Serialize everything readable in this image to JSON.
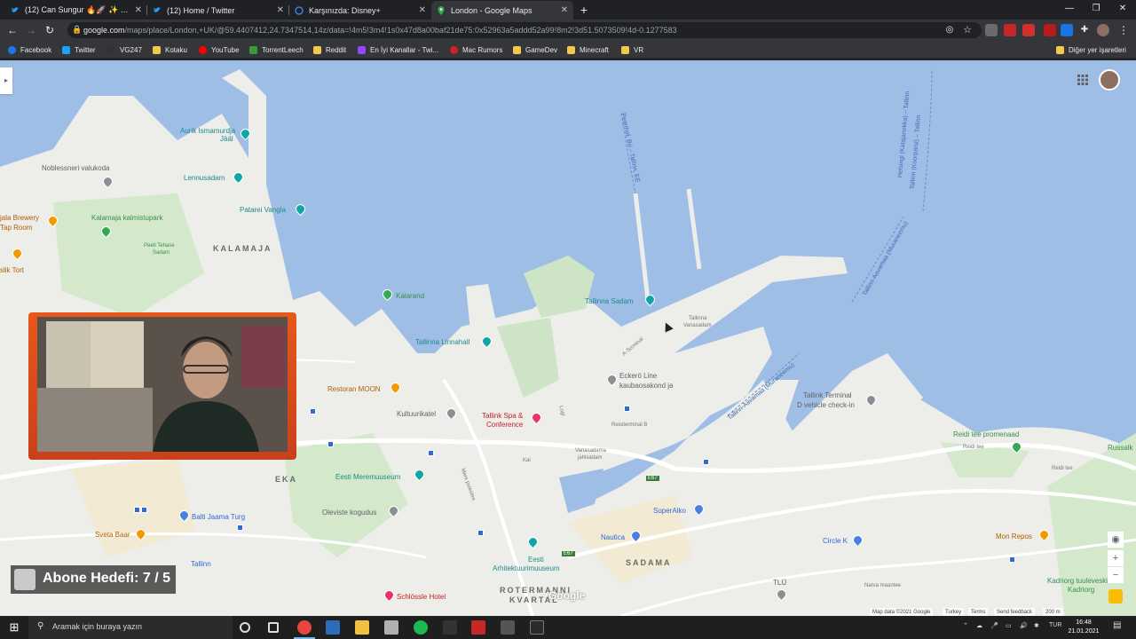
{
  "browser": {
    "tabs": [
      {
        "title": "(12) Can Sungur 🔥🚀 ✨ #KalkC",
        "icon": "twitter-icon",
        "active": false
      },
      {
        "title": "(12) Home / Twitter",
        "icon": "twitter-icon",
        "active": false
      },
      {
        "title": "Karşınızda: Disney+",
        "icon": "disney-icon",
        "active": false
      },
      {
        "title": "London - Google Maps",
        "icon": "maps-pin-icon",
        "active": true
      }
    ],
    "url_main": "google.com",
    "url_rest": "/maps/place/London,+UK/@59.4407412,24.7347514,14z/data=!4m5!3m4!1s0x47d8a00baf21de75:0x52963a5addd52a99!8m2!3d51.5073509!4d-0.1277583",
    "bookmarks": [
      {
        "label": "Facebook",
        "color": "#1877f2"
      },
      {
        "label": "Twitter",
        "color": "#1da1f2"
      },
      {
        "label": "VG247",
        "color": "#333333"
      },
      {
        "label": "Kotaku",
        "color": "#f2c94c"
      },
      {
        "label": "YouTube",
        "color": "#ff0000"
      },
      {
        "label": "TorrentLeech",
        "color": "#3a9b3a"
      },
      {
        "label": "Reddit",
        "color": "#f2c94c"
      },
      {
        "label": "En İyi Kanallar - Twi...",
        "color": "#9146ff"
      },
      {
        "label": "Mac Rumors",
        "color": "#cc2222"
      },
      {
        "label": "GameDev",
        "color": "#f2c94c"
      },
      {
        "label": "Minecraft",
        "color": "#f2c94c"
      },
      {
        "label": "VR",
        "color": "#f2c94c"
      }
    ],
    "other_bookmarks": "Diğer yer işaretleri"
  },
  "map": {
    "districts": [
      "KALAMAJA",
      "EKA",
      "SADAMA",
      "ROTERMANNI",
      "KVARTAL"
    ],
    "pois": [
      {
        "name": "Lennusadam",
        "kind": "teal"
      },
      {
        "name": "Patarei Vangla",
        "kind": "teal"
      },
      {
        "name": "Kalarand",
        "kind": "green"
      },
      {
        "name": "Tallinna Sadam",
        "kind": "teal"
      },
      {
        "name": "Tallinna Linnahall",
        "kind": "teal"
      },
      {
        "name": "Restoran MOON",
        "kind": "orange"
      },
      {
        "name": "Kultuurikatel",
        "kind": "gray"
      },
      {
        "name": "Tallink Spa &",
        "kind": "pink"
      },
      {
        "name": "Conference",
        "kind": "pink"
      },
      {
        "name": "Eckerö Line",
        "kind": "gray"
      },
      {
        "name": "kaubaosakond ja",
        "kind": "gray"
      },
      {
        "name": "Tallink Terminal",
        "kind": "gray"
      },
      {
        "name": "D vehicle check-in",
        "kind": "gray"
      },
      {
        "name": "Reidi tee promenaad",
        "kind": "green"
      },
      {
        "name": "Russalk",
        "kind": "green"
      },
      {
        "name": "Eesti Meremuuseum",
        "kind": "teal"
      },
      {
        "name": "Balti Jaama Turg",
        "kind": "blue"
      },
      {
        "name": "Sveta Baar",
        "kind": "orange"
      },
      {
        "name": "Oleviste kogudus",
        "kind": "gray"
      },
      {
        "name": "SuperAlko",
        "kind": "blue"
      },
      {
        "name": "Nautica",
        "kind": "blue"
      },
      {
        "name": "Eesti",
        "kind": "teal"
      },
      {
        "name": "Arhitektuurimuuseum",
        "kind": "teal"
      },
      {
        "name": "Circle K",
        "kind": "blue"
      },
      {
        "name": "Mon Repos",
        "kind": "orange"
      },
      {
        "name": "Kadriorg tuuleveski",
        "kind": "green"
      },
      {
        "name": "Kadriorg",
        "kind": "green"
      },
      {
        "name": "Schlössle Hotel",
        "kind": "pink"
      },
      {
        "name": "Aurik Ismamurdja",
        "kind": "teal"
      },
      {
        "name": "Jääl",
        "kind": "teal"
      },
      {
        "name": "Noblessneri valukoda",
        "kind": "gray"
      },
      {
        "name": "Kalamaja kalmistupark",
        "kind": "green"
      },
      {
        "name": "Peeti Tehase",
        "kind": "green"
      },
      {
        "name": "Sadam",
        "kind": "green"
      },
      {
        "name": "jala Brewery",
        "kind": "orange"
      },
      {
        "name": "Tap Room",
        "kind": "orange"
      },
      {
        "name": "slik Tort",
        "kind": "orange"
      },
      {
        "name": "Tallinn",
        "kind": "blue"
      },
      {
        "name": "TLÜ",
        "kind": "gray"
      }
    ],
    "small_labels": [
      "Tallinna",
      "Vanasadam",
      "Vanasadama",
      "jahisadam",
      "Reisiterminal B",
      "A-Terminal",
      "Loigi",
      "Kai",
      "Mere puiestee",
      "Reidi tee",
      "Narva maantee",
      "E67",
      "Logi"
    ],
    "water_labels": [
      "Tallinn-Aavamaa (Muraneemu)",
      "Tallinn (Koorpärsi) – Tallinn",
      "Helsingi (Katajanokka) – Tallinn",
      "Peterhof, Bü – Tallinn, EE"
    ],
    "google_logo": "Google",
    "attribution": [
      "Map data ©2021 Google",
      "Turkey",
      "Terms",
      "Send feedback",
      "200 m"
    ],
    "zoom_in": "+",
    "zoom_out": "−"
  },
  "overlay": {
    "subscriber_goal": "Abone Hedefi: 7 / 5"
  },
  "taskbar": {
    "search_placeholder": "Aramak için buraya yazın",
    "language": "TUR",
    "time": "16:48",
    "date": "21.01.2021"
  }
}
